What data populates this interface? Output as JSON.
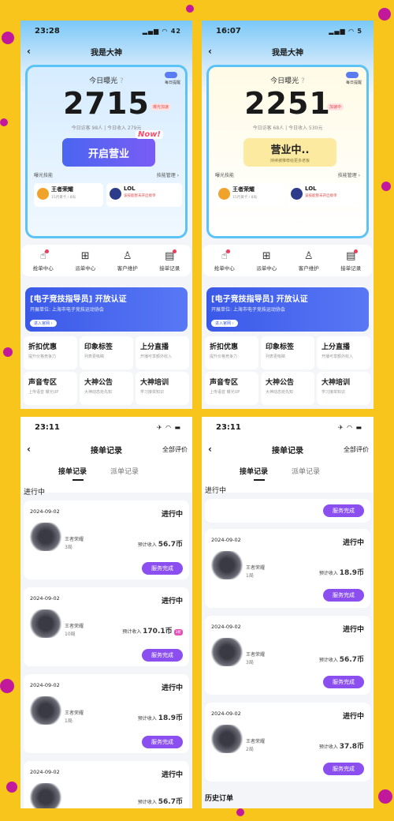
{
  "theme": {
    "purple": "#8b4ff0",
    "blue": "#3b59e8",
    "yellow": "#f7c51c",
    "magenta": "#c2189b"
  },
  "screen1": {
    "time": "23:28",
    "status_icons": "▂▄▆ ◠ 42",
    "title": "我是大神",
    "card": {
      "label": "今日曝光",
      "help": "?",
      "value": "2715",
      "visits": "今日访客 98人",
      "income": "今日收入 279元",
      "toggle_label": "每日提醒",
      "pill": "曝光加速"
    },
    "main_button": {
      "label": "开启营业",
      "sub": "",
      "badge": "Now!"
    },
    "skills": {
      "title": "曝光技能",
      "manage": "技能管理 ›",
      "items": [
        {
          "name": "王者荣耀",
          "meta": "15月黄卡 / 8局"
        },
        {
          "name": "LOL",
          "meta": "该技能暂未开启接单"
        }
      ]
    }
  },
  "screen2": {
    "time": "16:07",
    "status_icons": "▂▄▆ ◠ 5",
    "title": "我是大神",
    "card": {
      "label": "今日曝光",
      "help": "?",
      "value": "2251",
      "visits": "今日访客 68人",
      "income": "今日收入 530元",
      "toggle_label": "每日提醒",
      "pill": "加速中"
    },
    "main_button": {
      "label": "营业中..",
      "sub": "持续被推荐给更多老板"
    },
    "skills": {
      "title": "曝光技能",
      "manage": "技能管理 ›",
      "items": [
        {
          "name": "王者荣耀",
          "meta": "15月黄卡 / 8局"
        },
        {
          "name": "LOL",
          "meta": "该技能暂未开启接单"
        }
      ]
    }
  },
  "quick": [
    {
      "label": "抢单中心",
      "icon": "tap-icon"
    },
    {
      "label": "派单中心",
      "icon": "dispatch-icon"
    },
    {
      "label": "客户维护",
      "icon": "user-icon"
    },
    {
      "label": "接单记录",
      "icon": "record-icon"
    }
  ],
  "banner": {
    "title": "[电子竞技指导员] 开放认证",
    "sub": "开展单位: 上海市电子竞技运动协会",
    "btn": "进入官网 ›"
  },
  "services": [
    {
      "title": "折扣优惠",
      "sub": "提升价格竞争力"
    },
    {
      "title": "印象标签",
      "sub": "列表更吸睛"
    },
    {
      "title": "上分直播",
      "sub": "开播可享额外收入"
    },
    {
      "title": "声音专区",
      "sub": "上传语音 曝光UP"
    },
    {
      "title": "大神公告",
      "sub": "大神动态抢先知"
    },
    {
      "title": "大神培训",
      "sub": "学习接单知识"
    }
  ],
  "screen3": {
    "time": "23:11",
    "status_icons": "✈ ◠ ▬",
    "title": "接单记录",
    "right": "全部评价",
    "tabs": [
      "接单记录",
      "派单记录"
    ],
    "section": "进行中",
    "orders": [
      {
        "date": "2024-09-02",
        "status": "进行中",
        "game": "王者荣耀",
        "count": "3局",
        "income_label": "预计收入",
        "income": "56.7币",
        "tag": "",
        "btn": "服务完成"
      },
      {
        "date": "2024-09-02",
        "status": "进行中",
        "game": "王者荣耀",
        "count": "10局",
        "income_label": "预计收入",
        "income": "170.1币",
        "tag": "3折",
        "btn": "服务完成"
      },
      {
        "date": "2024-09-02",
        "status": "进行中",
        "game": "王者荣耀",
        "count": "1局",
        "income_label": "预计收入",
        "income": "18.9币",
        "tag": "",
        "btn": "服务完成"
      },
      {
        "date": "2024-09-02",
        "status": "进行中",
        "game": "",
        "count": "",
        "income_label": "预计收入",
        "income": "56.7币",
        "tag": "",
        "btn": ""
      }
    ]
  },
  "screen4": {
    "time": "23:11",
    "status_icons": "✈ ◠ ▬",
    "title": "接单记录",
    "right": "全部评价",
    "tabs": [
      "接单记录",
      "派单记录"
    ],
    "section": "进行中",
    "top_btn": "服务完成",
    "orders": [
      {
        "date": "2024-09-02",
        "status": "进行中",
        "game": "王者荣耀",
        "count": "1局",
        "income_label": "预计收入",
        "income": "18.9币",
        "btn": "服务完成"
      },
      {
        "date": "2024-09-02",
        "status": "进行中",
        "game": "王者荣耀",
        "count": "3局",
        "income_label": "预计收入",
        "income": "56.7币",
        "btn": "服务完成"
      },
      {
        "date": "2024-09-02",
        "status": "进行中",
        "game": "王者荣耀",
        "count": "2局",
        "income_label": "预计收入",
        "income": "37.8币",
        "btn": "服务完成"
      }
    ],
    "history": "历史订单"
  }
}
